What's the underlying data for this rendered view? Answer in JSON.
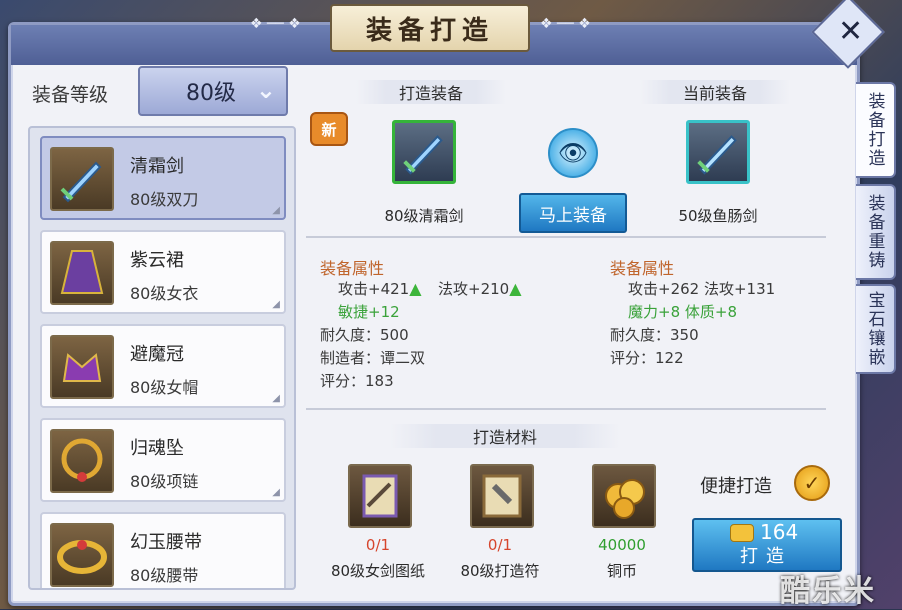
{
  "window": {
    "title": "装备打造"
  },
  "side_tabs": [
    {
      "label": "装备打造",
      "active": true
    },
    {
      "label": "装备重铸",
      "active": false
    },
    {
      "label": "宝石镶嵌",
      "active": false
    }
  ],
  "level": {
    "label": "装备等级",
    "value": "80级"
  },
  "items": [
    {
      "name": "清霜剑",
      "sub": "80级双刀",
      "icon": "sword-icon",
      "selected": true
    },
    {
      "name": "紫云裙",
      "sub": "80级女衣",
      "icon": "robe-icon",
      "selected": false
    },
    {
      "name": "避魔冠",
      "sub": "80级女帽",
      "icon": "crown-icon",
      "selected": false
    },
    {
      "name": "归魂坠",
      "sub": "80级项链",
      "icon": "necklace-icon",
      "selected": false
    },
    {
      "name": "幻玉腰带",
      "sub": "80级腰带",
      "icon": "belt-icon",
      "selected": false
    }
  ],
  "forge": {
    "new_badge": "新",
    "craft_header": "打造装备",
    "current_header": "当前装备",
    "craft_item": "80级清霜剑",
    "current_item": "50级鱼肠剑",
    "equip_button": "马上装备"
  },
  "attrs_left": {
    "head": "装备属性",
    "line1a": "攻击+421",
    "line1b": "法攻+210",
    "line2": "敏捷+12",
    "durability": "耐久度：500",
    "maker": "制造者：谭二双",
    "score": "评分：183"
  },
  "attrs_right": {
    "head": "装备属性",
    "line1": "攻击+262  法攻+131",
    "line2": "魔力+8  体质+8",
    "durability": "耐久度：350",
    "score": "评分：122"
  },
  "materials": {
    "header": "打造材料",
    "list": [
      {
        "count": "0/1",
        "name": "80级女剑图纸",
        "icon": "scroll-icon",
        "color": "#d6452c"
      },
      {
        "count": "0/1",
        "name": "80级打造符",
        "icon": "talisman-icon",
        "color": "#d6452c"
      },
      {
        "count": "40000",
        "name": "铜币",
        "icon": "coins-icon",
        "color": "#2f9e2f"
      }
    ]
  },
  "quick": {
    "label": "便捷打造",
    "checked": true
  },
  "craft_button": {
    "cost": "164",
    "label": "打造"
  },
  "watermark": "酷乐米"
}
